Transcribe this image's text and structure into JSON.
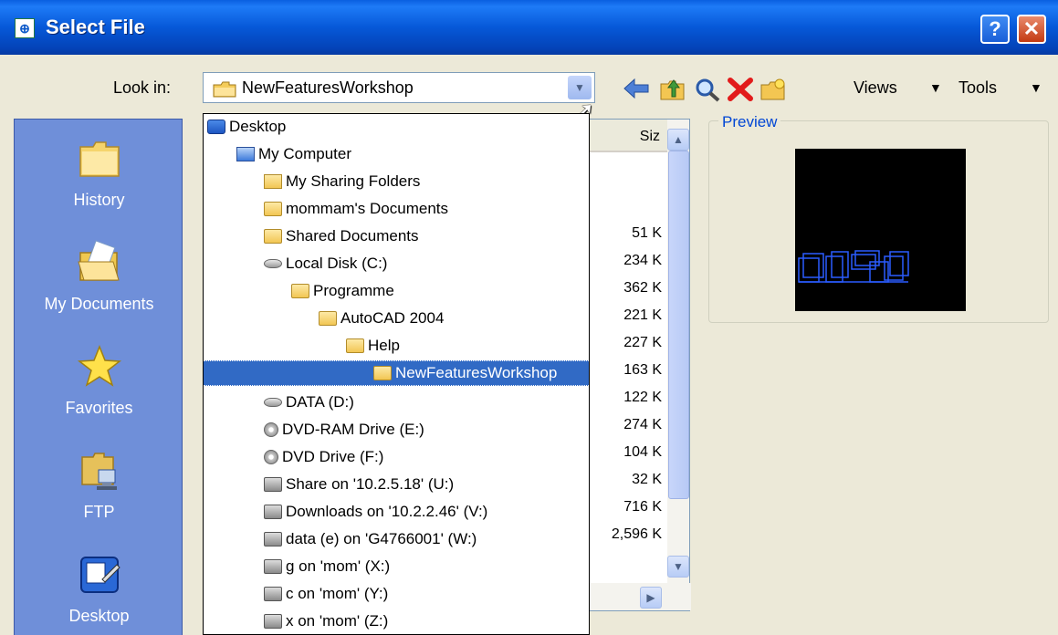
{
  "window": {
    "title": "Select File",
    "help_glyph": "?",
    "close_glyph": "✕"
  },
  "toolbar": {
    "look_in_label": "Look in:",
    "look_in_value": "NewFeaturesWorkshop",
    "back_icon": "back-arrow-icon",
    "up_icon": "up-folder-icon",
    "search_icon": "search-web-icon",
    "delete_icon": "delete-icon",
    "new_folder_icon": "create-folder-icon",
    "views_label": "Views",
    "tools_label": "Tools"
  },
  "places": [
    {
      "label": "History",
      "icon": "folder-icon"
    },
    {
      "label": "My Documents",
      "icon": "open-folder-icon"
    },
    {
      "label": "Favorites",
      "icon": "star-icon"
    },
    {
      "label": "FTP",
      "icon": "ftp-icon"
    },
    {
      "label": "Desktop",
      "icon": "desktop-icon"
    }
  ],
  "file_list": {
    "size_header": "Siz",
    "sizes": [
      "51 K",
      "234 K",
      "362 K",
      "221 K",
      "227 K",
      "163 K",
      "122 K",
      "274 K",
      "104 K",
      "32 K",
      "716 K",
      "2,596 K"
    ]
  },
  "preview": {
    "label": "Preview"
  },
  "dropdown": {
    "items": [
      {
        "label": "Desktop",
        "icon": "desktop-icon"
      },
      {
        "label": "My Computer",
        "icon": "computer-icon"
      },
      {
        "label": "My Sharing Folders",
        "icon": "shared-folder-icon"
      },
      {
        "label": "mommam's Documents",
        "icon": "folder-icon"
      },
      {
        "label": "Shared Documents",
        "icon": "folder-icon"
      },
      {
        "label": "Local Disk (C:)",
        "icon": "hard-drive-icon"
      },
      {
        "label": "Programme",
        "icon": "folder-icon"
      },
      {
        "label": "AutoCAD 2004",
        "icon": "folder-icon"
      },
      {
        "label": "Help",
        "icon": "folder-icon"
      },
      {
        "label": "NewFeaturesWorkshop",
        "icon": "open-folder-icon",
        "selected": true
      },
      {
        "label": "DATA (D:)",
        "icon": "hard-drive-icon"
      },
      {
        "label": "DVD-RAM Drive (E:)",
        "icon": "optical-drive-icon"
      },
      {
        "label": "DVD Drive (F:)",
        "icon": "optical-drive-icon"
      },
      {
        "label": "Share on '10.2.5.18' (U:)",
        "icon": "network-drive-icon"
      },
      {
        "label": "Downloads on '10.2.2.46' (V:)",
        "icon": "network-drive-icon"
      },
      {
        "label": "data (e) on 'G4766001' (W:)",
        "icon": "network-drive-icon"
      },
      {
        "label": "g on 'mom' (X:)",
        "icon": "network-drive-icon"
      },
      {
        "label": "c on 'mom' (Y:)",
        "icon": "network-drive-icon"
      },
      {
        "label": "x on 'mom' (Z:)",
        "icon": "network-drive-icon"
      }
    ]
  }
}
